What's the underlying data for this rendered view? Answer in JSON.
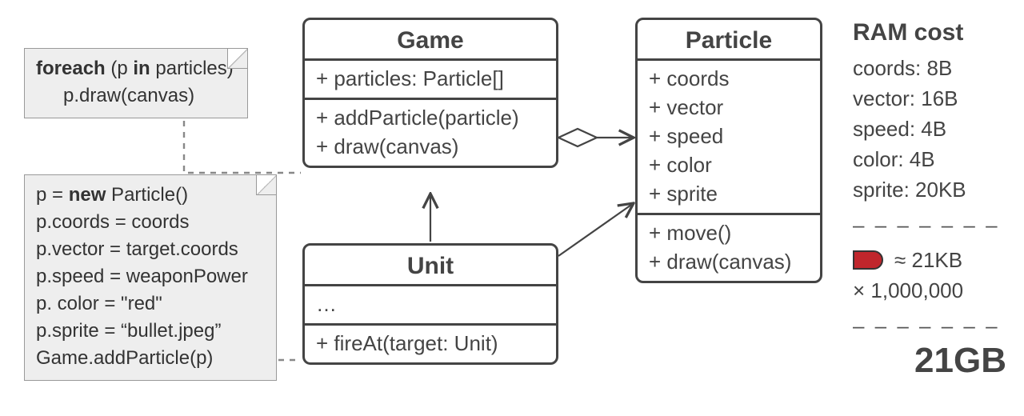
{
  "game": {
    "title": "Game",
    "attrs": [
      "+ particles: Particle[]"
    ],
    "ops": [
      "+ addParticle(particle)",
      "+ draw(canvas)"
    ]
  },
  "unit": {
    "title": "Unit",
    "attrs": [
      "…"
    ],
    "ops": [
      "+ fireAt(target: Unit)"
    ]
  },
  "particle": {
    "title": "Particle",
    "attrs": [
      "+ coords",
      "+ vector",
      "+ speed",
      "+ color",
      "+ sprite"
    ],
    "ops": [
      "+ move()",
      "+ draw(canvas)"
    ]
  },
  "notes": {
    "draw": {
      "tokens": [
        "foreach",
        " (p ",
        "in",
        " particles)"
      ],
      "body": "p.draw(canvas)"
    },
    "fireAt": [
      [
        [
          "p = "
        ],
        [
          "new",
          true
        ],
        [
          " Particle()"
        ]
      ],
      [
        [
          "p.coords = coords"
        ]
      ],
      [
        [
          "p.vector = target.coords"
        ]
      ],
      [
        [
          "p.speed = weaponPower"
        ]
      ],
      [
        [
          "p. color = \"red\""
        ]
      ],
      [
        [
          "p.sprite = “bullet.jpeg”"
        ]
      ],
      [
        [
          "Game.addParticle(p)"
        ]
      ]
    ]
  },
  "ram": {
    "heading": "RAM cost",
    "lines": [
      "coords: 8B",
      "vector: 16B",
      "speed: 4B",
      "color: 4B",
      "sprite: 20KB"
    ],
    "per": "≈ 21KB",
    "mult": "× 1,000,000",
    "total": "21GB",
    "dash": "– – – – – – –"
  }
}
